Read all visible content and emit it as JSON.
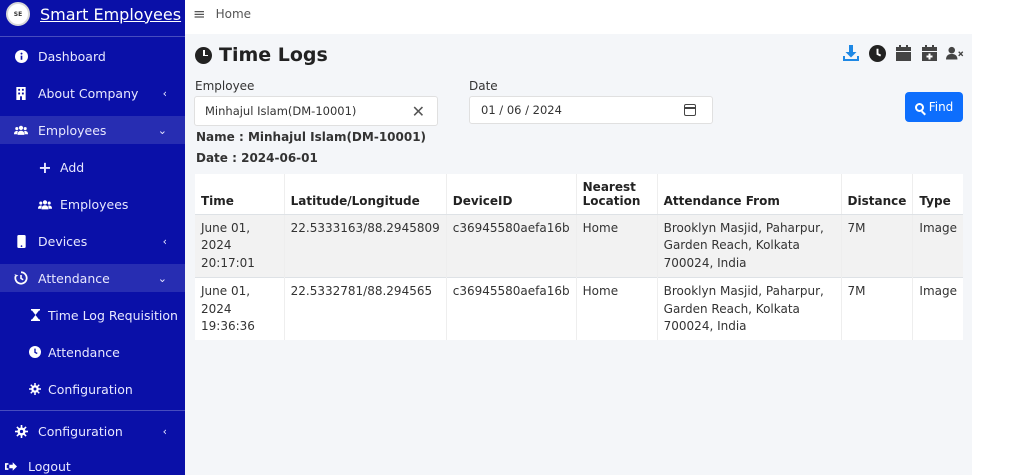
{
  "app": {
    "brand": "Smart Employees"
  },
  "topbar": {
    "breadcrumb": "Home"
  },
  "sidebar": {
    "items": [
      {
        "label": "Dashboard",
        "icon": "info-circle-icon"
      },
      {
        "label": "About Company",
        "icon": "building-icon"
      },
      {
        "label": "Employees",
        "icon": "users-icon"
      },
      {
        "label": "Add",
        "icon": "plus-icon"
      },
      {
        "label": "Employees",
        "icon": "users-icon"
      },
      {
        "label": "Devices",
        "icon": "mobile-icon"
      },
      {
        "label": "Attendance",
        "icon": "history-icon"
      },
      {
        "label": "Time Log Requisition",
        "icon": "hourglass-icon"
      },
      {
        "label": "Attendance",
        "icon": "clock-icon"
      },
      {
        "label": "Configuration",
        "icon": "gear-icon"
      },
      {
        "label": "Configuration",
        "icon": "gear-icon"
      },
      {
        "label": "Logout",
        "icon": "sign-out-icon"
      }
    ]
  },
  "page": {
    "title": "Time Logs",
    "employee_label": "Employee",
    "employee_value": "Minhajul Islam(DM-10001)",
    "date_label": "Date",
    "date_value": "01 / 06 / 2024",
    "find_label": "Find",
    "name_info": "Name : Minhajul Islam(DM-10001)",
    "date_info": "Date : 2024-06-01"
  },
  "table": {
    "headers": [
      "Time",
      "Latitude/Longitude",
      "DeviceID",
      "Nearest Location",
      "Attendance From",
      "Distance",
      "Type"
    ],
    "rows": [
      {
        "time": "June 01, 2024 20:17:01",
        "latlng": "22.5333163/88.2945809",
        "device": "c36945580aefa16b",
        "nearest": "Home",
        "from": "Brooklyn Masjid, Paharpur, Garden Reach, Kolkata 700024, India",
        "distance": "7M",
        "type": "Image"
      },
      {
        "time": "June 01, 2024 19:36:36",
        "latlng": "22.5332781/88.294565",
        "device": "c36945580aefa16b",
        "nearest": "Home",
        "from": "Brooklyn Masjid, Paharpur, Garden Reach, Kolkata 700024, India",
        "distance": "7M",
        "type": "Image"
      }
    ]
  },
  "colors": {
    "sidebar": "#0a10a8",
    "accent": "#0d6efd",
    "download_icon": "#1e88e5"
  }
}
